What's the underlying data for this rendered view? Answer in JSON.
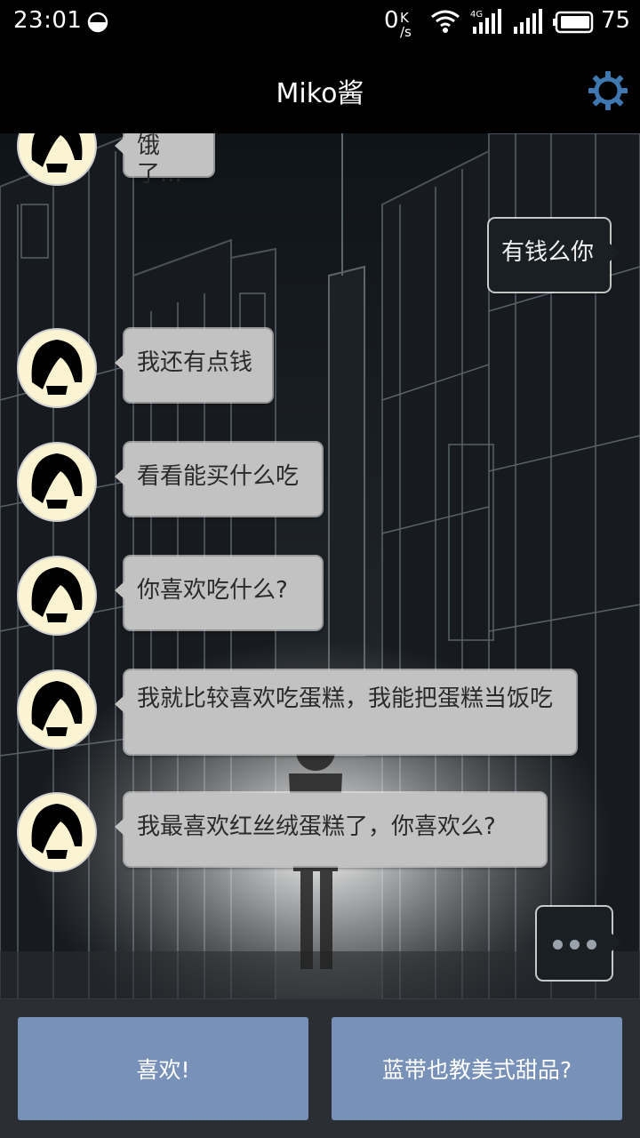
{
  "status_bar": {
    "time": "23:01",
    "net_speed_value": "0",
    "net_speed_unit_top": "K",
    "net_speed_unit_bottom": "/s",
    "network_type": "4G",
    "battery": "75"
  },
  "header": {
    "title": "Miko酱",
    "settings_icon": "gear-icon"
  },
  "messages": [
    {
      "side": "incoming",
      "text": "饿了..."
    },
    {
      "side": "outgoing",
      "text": "有钱么你"
    },
    {
      "side": "incoming",
      "text": "我还有点钱"
    },
    {
      "side": "incoming",
      "text": "看看能买什么吃"
    },
    {
      "side": "incoming",
      "text": "你喜欢吃什么?"
    },
    {
      "side": "incoming",
      "text": "我就比较喜欢吃蛋糕，我能把蛋糕当饭吃"
    },
    {
      "side": "incoming",
      "text": "我最喜欢红丝绒蛋糕了，你喜欢么?"
    }
  ],
  "typing_indicator": "ellipsis-icon",
  "reply_options": [
    {
      "label": "喜欢!"
    },
    {
      "label": "蓝带也教美式甜品?"
    }
  ],
  "colors": {
    "status_bar_bg": "#000000",
    "incoming_bubble": "#c2c2c2",
    "outgoing_bubble": "#1a1f24",
    "reply_button": "#7891b9",
    "settings_icon": "#3f77b0",
    "avatar_bg": "#fbf4d3"
  }
}
